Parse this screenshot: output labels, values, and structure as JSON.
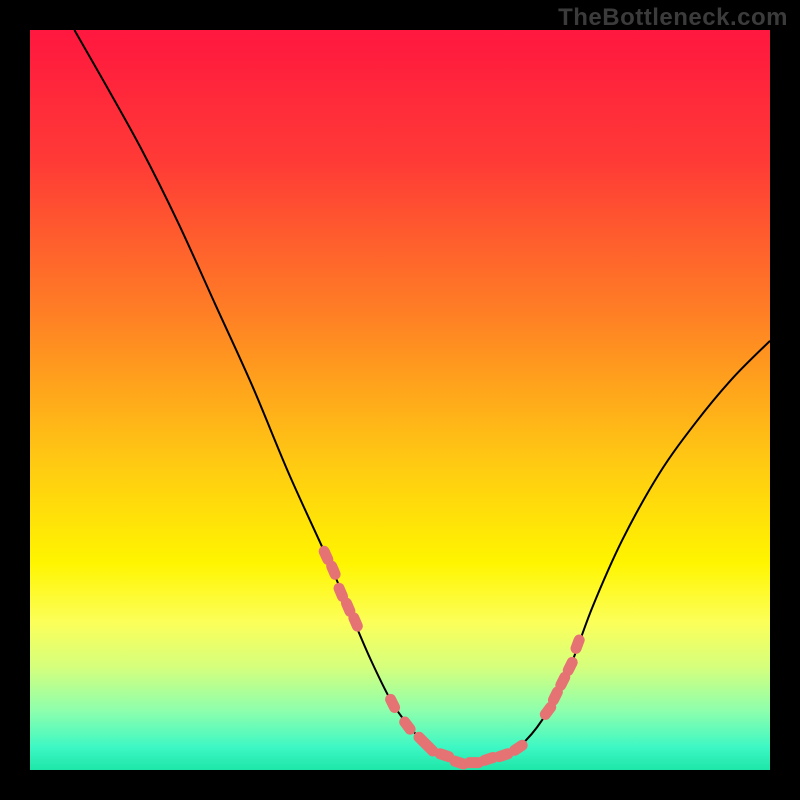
{
  "watermark": "TheBottleneck.com",
  "chart_data": {
    "type": "line",
    "title": "",
    "xlabel": "",
    "ylabel": "",
    "xlim": [
      0,
      100
    ],
    "ylim": [
      0,
      100
    ],
    "grid": false,
    "legend": false,
    "series": [
      {
        "name": "curve",
        "x": [
          6,
          10,
          15,
          20,
          25,
          30,
          35,
          40,
          43,
          46,
          49,
          52,
          55,
          58,
          61,
          64,
          67,
          70,
          73,
          76,
          80,
          85,
          90,
          95,
          100
        ],
        "y": [
          100,
          93,
          84,
          74,
          63,
          52,
          40,
          29,
          22,
          15,
          9,
          5,
          2,
          1,
          1,
          2,
          4,
          8,
          14,
          22,
          31,
          40,
          47,
          53,
          58
        ]
      }
    ],
    "highlight_points": {
      "name": "markers",
      "x": [
        40,
        41,
        42,
        43,
        44,
        49,
        51,
        53,
        54,
        56,
        58,
        60,
        62,
        64,
        66,
        70,
        71,
        72,
        73,
        74
      ],
      "y": [
        29,
        27,
        24,
        22,
        20,
        9,
        6,
        4,
        3,
        2,
        1,
        1,
        1.5,
        2,
        3,
        8,
        10,
        12,
        14,
        17
      ]
    },
    "background_gradient": {
      "stops": [
        {
          "offset": 0.0,
          "color": "#ff173f"
        },
        {
          "offset": 0.18,
          "color": "#ff3b36"
        },
        {
          "offset": 0.38,
          "color": "#ff7e25"
        },
        {
          "offset": 0.58,
          "color": "#ffc813"
        },
        {
          "offset": 0.72,
          "color": "#fff500"
        },
        {
          "offset": 0.8,
          "color": "#fcff59"
        },
        {
          "offset": 0.86,
          "color": "#d6ff7c"
        },
        {
          "offset": 0.92,
          "color": "#8dffad"
        },
        {
          "offset": 0.97,
          "color": "#3cf7c4"
        },
        {
          "offset": 1.0,
          "color": "#1ee6a8"
        }
      ]
    }
  }
}
